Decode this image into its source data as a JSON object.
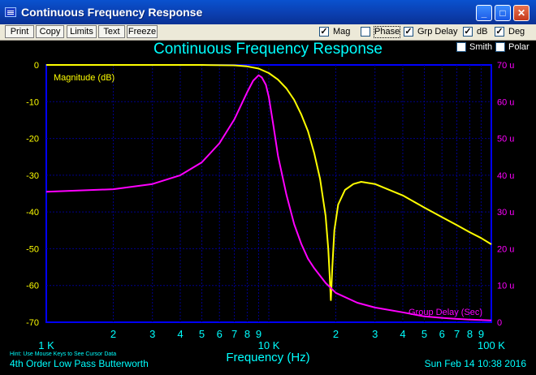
{
  "window": {
    "title": "Continuous Frequency Response",
    "minimize_label": "_",
    "maximize_label": "□",
    "close_label": "✕"
  },
  "toolbar": {
    "buttons": [
      "Print",
      "Copy",
      "Limits",
      "Text",
      "Freeze"
    ],
    "checks": [
      {
        "label": "Mag",
        "checked": true
      },
      {
        "label": "Phase",
        "checked": false
      },
      {
        "label": "Grp Delay",
        "checked": true
      },
      {
        "label": "dB",
        "checked": true
      },
      {
        "label": "Deg",
        "checked": true
      },
      {
        "label": "Smith",
        "checked": false
      },
      {
        "label": "Polar",
        "checked": false
      }
    ]
  },
  "chart_data": {
    "type": "line",
    "title": "Continuous Frequency Response",
    "xlabel": "Frequency (Hz)",
    "x_scale": "log",
    "xlim": [
      1000,
      100000
    ],
    "x_major_ticks": [
      "1 K",
      "10 K",
      "100 K"
    ],
    "x_minor_ticks": [
      "2",
      "3",
      "4",
      "5",
      "6",
      "7",
      "8",
      "9",
      "2",
      "3",
      "4",
      "5",
      "6",
      "7",
      "8",
      "9"
    ],
    "left_axis": {
      "ylim": [
        -70,
        0
      ],
      "ticks": [
        "0",
        "-10",
        "-20",
        "-30",
        "-40",
        "-50",
        "-60",
        "-70"
      ]
    },
    "right_axis": {
      "ylim": [
        0,
        70
      ],
      "ticks": [
        "70 u",
        "60 u",
        "50 u",
        "40 u",
        "30 u",
        "20 u",
        "10 u",
        "0"
      ]
    },
    "grid": true,
    "series": [
      {
        "name": "Magnitude (dB)",
        "color": "#ffff00",
        "axis": "left",
        "x": [
          1000,
          3000,
          5000,
          7000,
          8000,
          9000,
          10000,
          11000,
          12000,
          13000,
          14000,
          15000,
          16000,
          17000,
          18000,
          18500,
          18800,
          19000,
          19300,
          19700,
          20500,
          22000,
          24000,
          26000,
          30000,
          40000,
          50000,
          60000,
          70000,
          80000,
          90000,
          100000
        ],
        "y": [
          0,
          0,
          0,
          -0.1,
          -0.4,
          -1.0,
          -2.2,
          -4.0,
          -6.4,
          -9.5,
          -13.5,
          -18,
          -24,
          -31,
          -41,
          -50,
          -58,
          -64,
          -55,
          -45,
          -38,
          -34,
          -32.4,
          -31.8,
          -32.4,
          -35.5,
          -38.8,
          -41.4,
          -43.6,
          -45.5,
          -47.1,
          -48.8
        ]
      },
      {
        "name": "Group Delay (Sec)",
        "color": "#ff00ff",
        "axis": "right",
        "x": [
          1000,
          2000,
          3000,
          4000,
          5000,
          6000,
          7000,
          8000,
          8500,
          9000,
          9300,
          9700,
          10000,
          10500,
          11000,
          12000,
          13000,
          14000,
          15000,
          16000,
          18000,
          20000,
          25000,
          30000,
          40000,
          50000,
          60000,
          70000,
          80000,
          90000,
          100000
        ],
        "y": [
          35.5,
          36.2,
          37.6,
          40,
          43.5,
          48.7,
          55.2,
          62.6,
          65.7,
          67.2,
          66.6,
          64.6,
          61.3,
          53.3,
          45.3,
          34.7,
          26.7,
          21.3,
          17.3,
          14.7,
          10.7,
          8.0,
          5.3,
          4.0,
          2.7,
          1.6,
          1.2,
          0.9,
          0.7,
          0.6,
          0.5
        ]
      }
    ],
    "annotations": [
      "Magnitude (dB)",
      "Group Delay (Sec)"
    ]
  },
  "status": {
    "hint": "Hint: Use Mouse Keys to See Cursor Data",
    "filter_description": "4th Order Low Pass Butterworth",
    "timestamp": "Sun Feb 14 10:38 2016"
  },
  "colors": {
    "axis_left": "#ffff00",
    "axis_right": "#ff00ff",
    "axis_x": "#00ffff",
    "grid": "#00008c",
    "plot_border": "#0000ff"
  }
}
